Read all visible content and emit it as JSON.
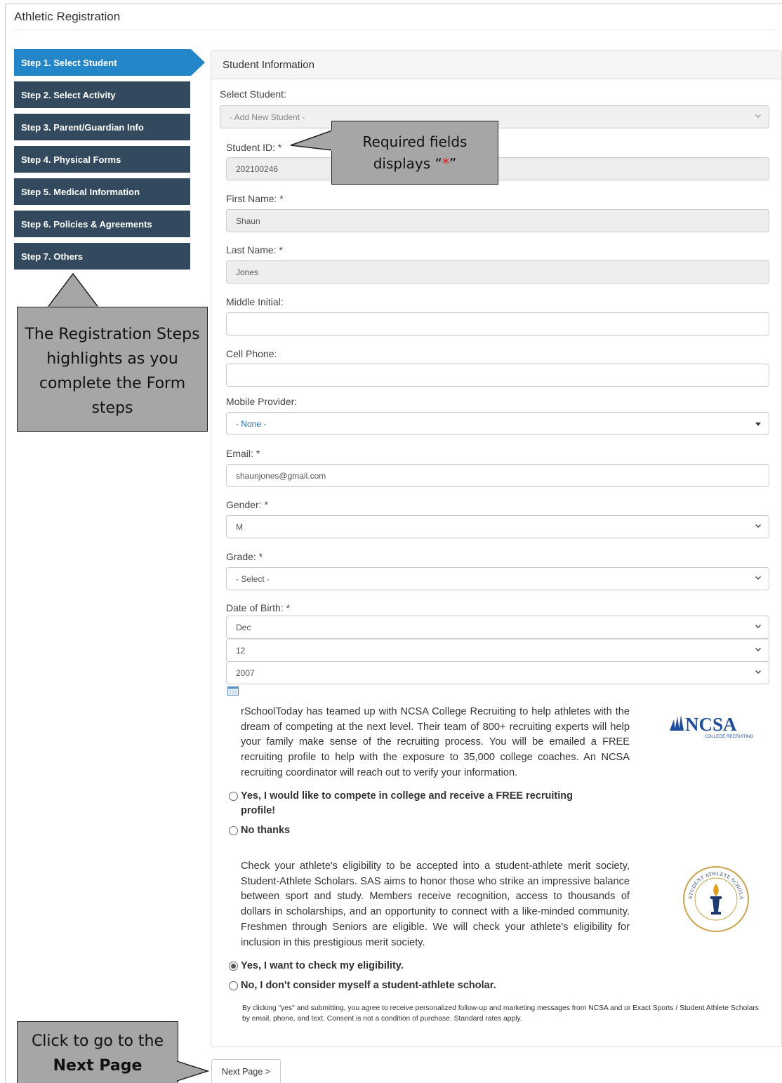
{
  "page": {
    "title": "Athletic Registration"
  },
  "steps": [
    {
      "label": "Step 1. Select Student",
      "active": true
    },
    {
      "label": "Step 2. Select Activity"
    },
    {
      "label": "Step 3. Parent/Guardian Info"
    },
    {
      "label": "Step 4. Physical Forms"
    },
    {
      "label": "Step 5. Medical Information"
    },
    {
      "label": "Step 6. Policies & Agreements"
    },
    {
      "label": "Step 7. Others"
    }
  ],
  "panel": {
    "heading": "Student Information"
  },
  "form": {
    "select_student_label": "Select Student:",
    "select_student_value": "- Add New Student -",
    "student_id_label": "Student ID: *",
    "student_id_value": "202100246",
    "first_name_label": "First Name: *",
    "first_name_value": "Shaun",
    "last_name_label": "Last Name: *",
    "last_name_value": "Jones",
    "middle_initial_label": "Middle Initial:",
    "middle_initial_value": "",
    "cell_phone_label": "Cell Phone:",
    "cell_phone_value": "",
    "mobile_provider_label": "Mobile Provider:",
    "mobile_provider_value": "- None -",
    "email_label": "Email: *",
    "email_value": "shaunjones@gmail.com",
    "gender_label": "Gender: *",
    "gender_value": "M",
    "grade_label": "Grade: *",
    "grade_value": "- Select -",
    "dob_label": "Date of Birth: *",
    "dob_month": "Dec",
    "dob_day": "12",
    "dob_year": "2007"
  },
  "ncsa": {
    "text": "rSchoolToday has teamed up with NCSA College Recruiting to help athletes with the dream of competing at the next level. Their team of 800+ recruiting experts will help your family make sense of the recruiting process. You will be emailed a FREE recruiting profile to help with the exposure to 35,000 college coaches. An NCSA recruiting coordinator will reach out to verify your information.",
    "logo_text": "NCSA",
    "logo_subtext": "COLLEGE RECRUITING",
    "option_yes": "Yes, I would like to compete in college and receive a FREE recruiting profile!",
    "option_no": "No thanks"
  },
  "sas": {
    "text": "Check your athlete's eligibility to be accepted into a student-athlete merit society, Student-Athlete Scholars. SAS aims to honor those who strike an impressive balance between sport and study. Members receive recognition, access to thousands of dollars in scholarships, and an opportunity to connect with a like-minded community. Freshmen through Seniors are eligible. We will check your athlete's eligibility for inclusion in this prestigious merit society.",
    "logo_text": "STUDENT ATHLETE SCHOLARS",
    "option_yes": "Yes, I want to check my eligibility.",
    "option_no": "No, I don't consider myself a student-athlete scholar.",
    "selected": "yes",
    "disclaimer": "By clicking \"yes\" and submitting, you agree to receive personalized follow-up and marketing messages from NCSA and or Exact Sports / Student Athlete Scholars by email, phone, and text. Consent is not a condition of purchase. Standard rates apply."
  },
  "next_button": "Next Page >",
  "callouts": {
    "required_line1": "Required fields",
    "required_line2_pre": "displays “",
    "required_star": "*",
    "required_line2_post": "”",
    "steps_text": "The Registration Steps highlights as you complete the Form steps",
    "next_pre": "Click to go to the ",
    "next_bold": "Next Page"
  },
  "colors": {
    "step_active": "#2386c8",
    "step_inactive": "#334a5e",
    "callout_fill": "#a6a6a6",
    "required_star": "#e02020",
    "ncsa_blue": "#1f4e9c"
  }
}
